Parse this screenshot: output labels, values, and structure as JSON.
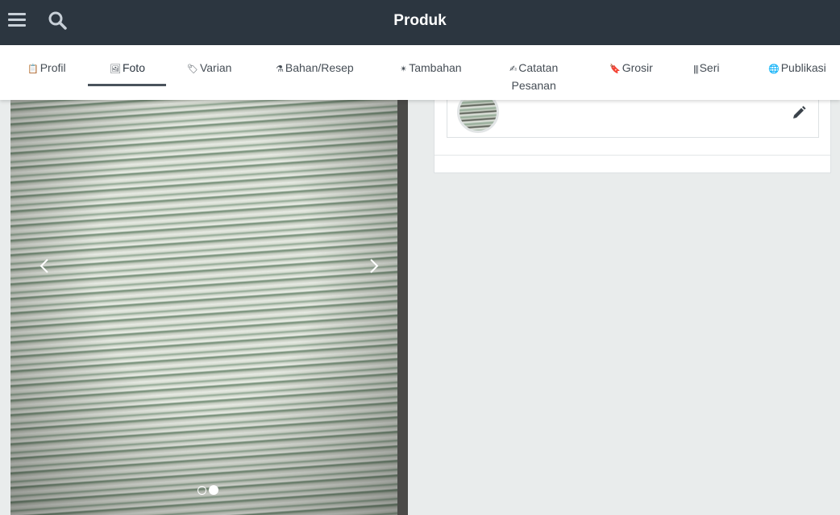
{
  "appbar": {
    "title": "Produk",
    "menu_icon": "hamburger-menu-icon",
    "search_icon": "search-icon",
    "background": "#2c3640"
  },
  "tabs": [
    {
      "icon": "📋",
      "icon_name": "clipboard-icon",
      "label": "Profil"
    },
    {
      "icon": "🖼",
      "icon_name": "picture-icon",
      "label": "Foto",
      "active": true
    },
    {
      "icon": "🏷",
      "icon_name": "tag-icon",
      "label": "Varian"
    },
    {
      "icon": "⚗",
      "icon_name": "flask-icon",
      "label": "Bahan/Resep"
    },
    {
      "icon": "✴",
      "icon_name": "star-burst-icon",
      "label": "Tambahan"
    },
    {
      "icon": "✍",
      "icon_name": "note-pencil-icon",
      "label": "Catatan",
      "label2": "Pesanan"
    },
    {
      "icon": "🔖",
      "icon_name": "bookmark-icon",
      "label": "Grosir"
    },
    {
      "icon": "|||",
      "icon_name": "barcode-icon",
      "label": "Seri"
    },
    {
      "icon": "🌐",
      "icon_name": "globe-icon",
      "label": "Publikasi"
    }
  ],
  "carousel": {
    "slide_count": 2,
    "active_slide": 2,
    "prev_icon": "chevron-left-icon",
    "next_icon": "chevron-right-icon"
  },
  "photo_card": {
    "edit_icon": "pencil-icon"
  }
}
